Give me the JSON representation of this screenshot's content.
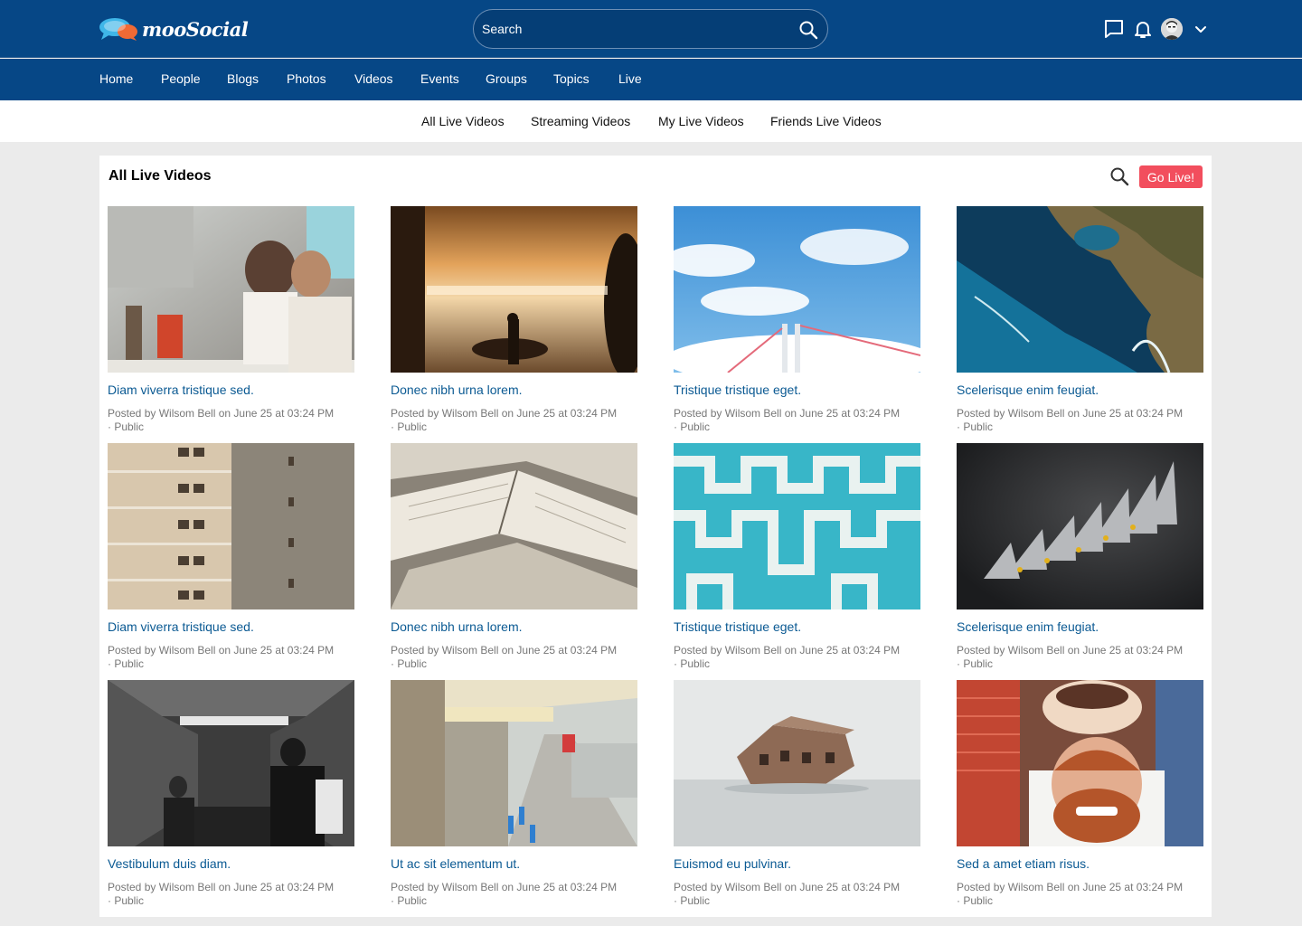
{
  "header": {
    "logo_text": "mooSocial",
    "search_placeholder": "Search"
  },
  "main_nav": [
    "Home",
    "People",
    "Blogs",
    "Photos",
    "Videos",
    "Events",
    "Groups",
    "Topics",
    "Live"
  ],
  "sub_nav": [
    "All Live Videos",
    "Streaming Videos",
    "My Live Videos",
    "Friends Live Videos"
  ],
  "panel": {
    "title": "All Live Videos",
    "go_live_label": "Go Live!"
  },
  "videos": [
    {
      "title": "Diam viverra tristique sed.",
      "posted": "Posted by Wilsom Bell on June 25 at 03:24 PM",
      "privacy": "· Public"
    },
    {
      "title": "Donec nibh urna lorem.",
      "posted": "Posted by Wilsom Bell on June 25 at 03:24 PM",
      "privacy": "· Public"
    },
    {
      "title": "Tristique tristique eget.",
      "posted": "Posted by Wilsom Bell on June 25 at 03:24 PM",
      "privacy": "· Public"
    },
    {
      "title": "Scelerisque enim feugiat.",
      "posted": "Posted by Wilsom Bell on June 25 at 03:24 PM",
      "privacy": "· Public"
    },
    {
      "title": "Diam viverra tristique sed.",
      "posted": "Posted by Wilsom Bell on June 25 at 03:24 PM",
      "privacy": "· Public"
    },
    {
      "title": "Donec nibh urna lorem.",
      "posted": "Posted by Wilsom Bell on June 25 at 03:24 PM",
      "privacy": "· Public"
    },
    {
      "title": "Tristique tristique eget.",
      "posted": "Posted by Wilsom Bell on June 25 at 03:24 PM",
      "privacy": "· Public"
    },
    {
      "title": "Scelerisque enim feugiat.",
      "posted": "Posted by Wilsom Bell on June 25 at 03:24 PM",
      "privacy": "· Public"
    },
    {
      "title": "Vestibulum duis diam.",
      "posted": "Posted by Wilsom Bell on June 25 at 03:24 PM",
      "privacy": "· Public"
    },
    {
      "title": "Ut ac sit elementum ut.",
      "posted": "Posted by Wilsom Bell on June 25 at 03:24 PM",
      "privacy": "· Public"
    },
    {
      "title": "Euismod eu pulvinar.",
      "posted": "Posted by Wilsom Bell on June 25 at 03:24 PM",
      "privacy": "· Public"
    },
    {
      "title": "Sed a amet etiam risus.",
      "posted": "Posted by Wilsom Bell on June 25 at 03:24 PM",
      "privacy": "· Public"
    }
  ],
  "icons": {
    "search": "search-icon",
    "messages": "chat-bubble-icon",
    "notifications": "bell-icon",
    "user_menu": "chevron-down-icon",
    "go_live_search": "search-icon"
  },
  "colors": {
    "header_bg": "#064786",
    "link": "#0b5a93",
    "go_live": "#f24e5d",
    "page_bg": "#ebebeb"
  }
}
